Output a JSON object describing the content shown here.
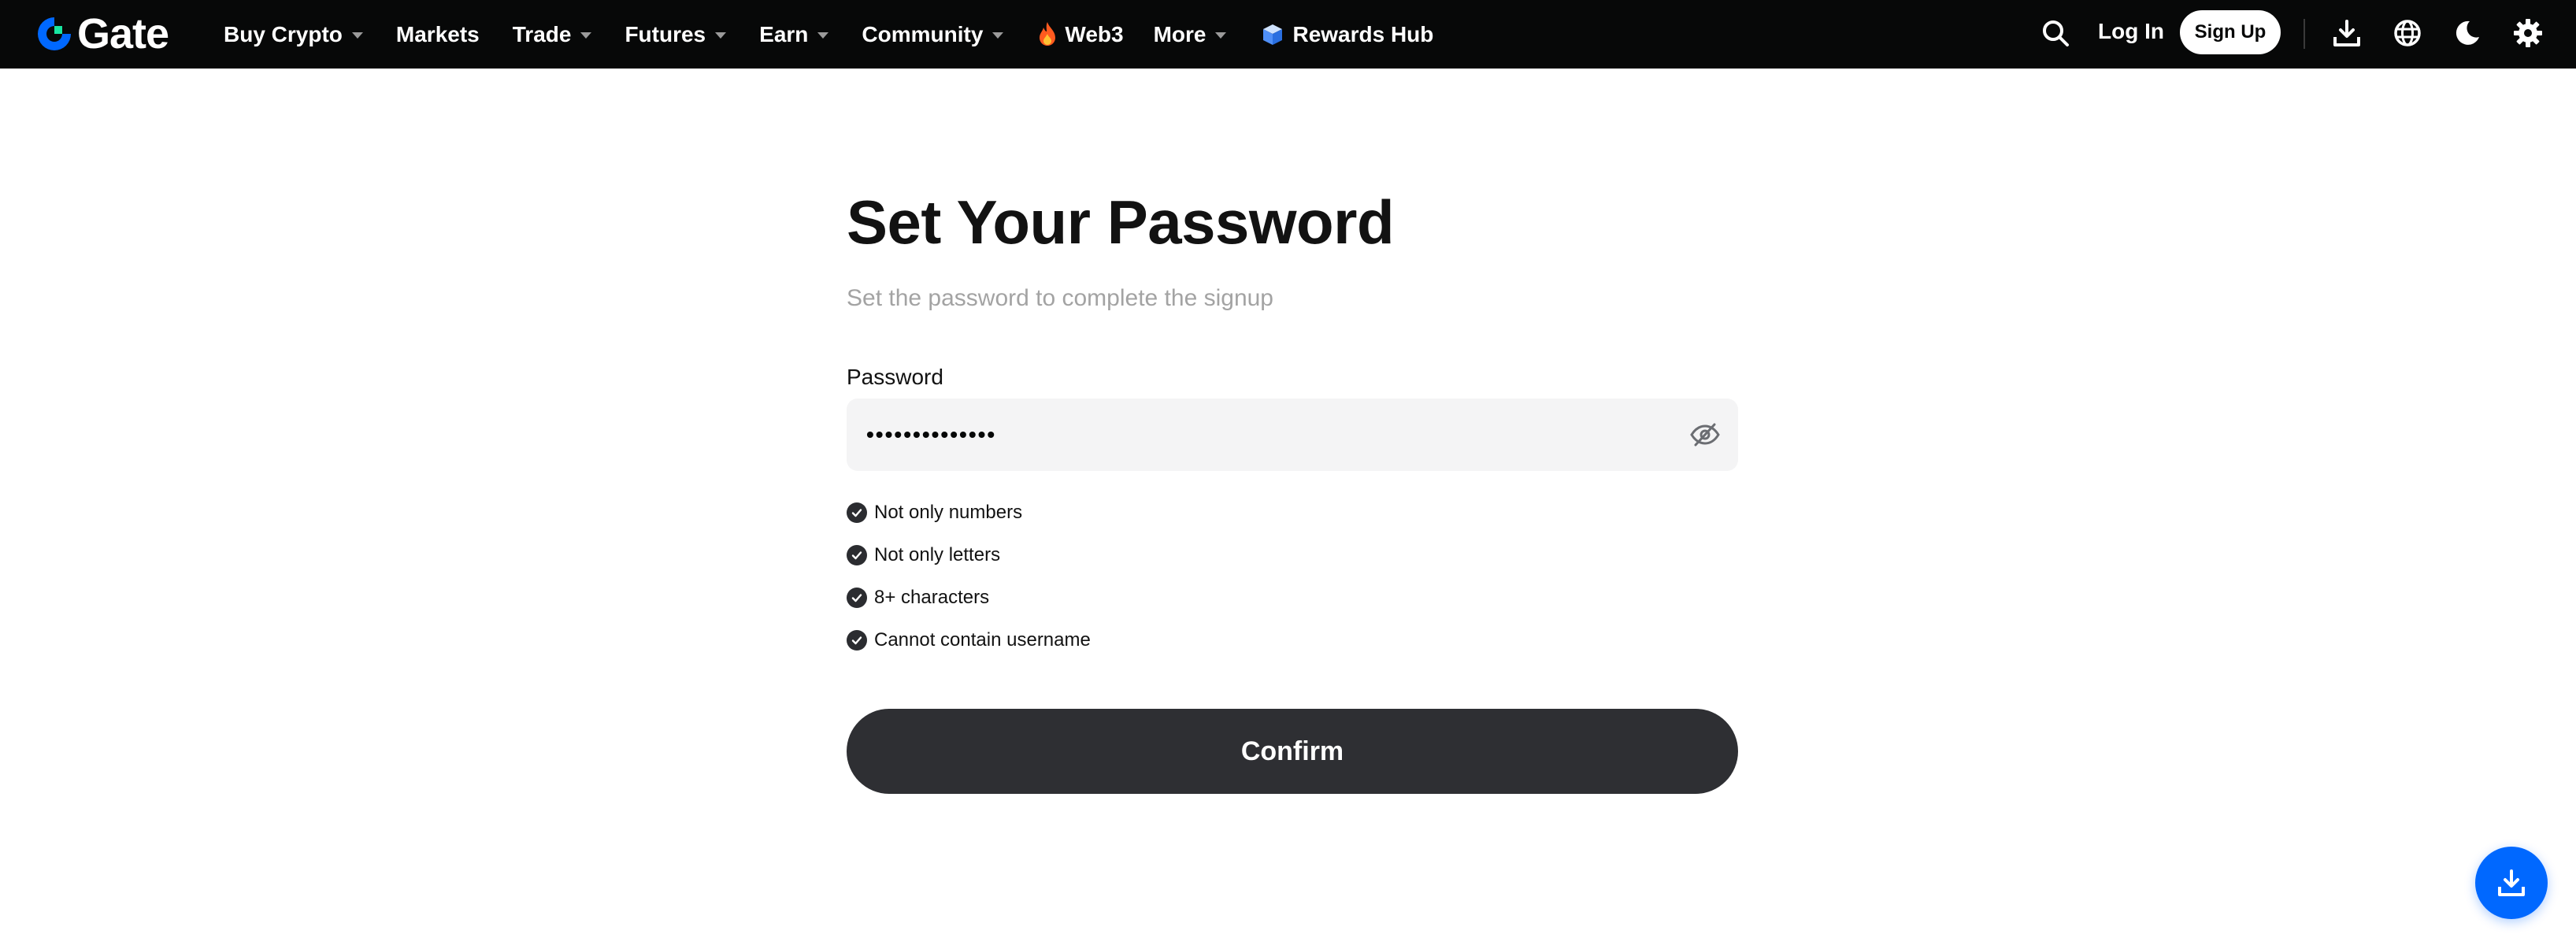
{
  "header": {
    "logo_text": "Gate",
    "nav": [
      {
        "label": "Buy Crypto",
        "has_caret": true
      },
      {
        "label": "Markets",
        "has_caret": false
      },
      {
        "label": "Trade",
        "has_caret": true
      },
      {
        "label": "Futures",
        "has_caret": true
      },
      {
        "label": "Earn",
        "has_caret": true
      },
      {
        "label": "Community",
        "has_caret": true
      },
      {
        "label": "Web3",
        "has_caret": false,
        "icon": "flame-icon"
      },
      {
        "label": "More",
        "has_caret": true
      },
      {
        "label": "Rewards Hub",
        "has_caret": false,
        "icon": "cube-icon"
      }
    ],
    "login_label": "Log In",
    "signup_label": "Sign Up",
    "right_icons": [
      "search-icon",
      "download-icon",
      "globe-icon",
      "moon-icon",
      "gear-icon"
    ]
  },
  "form": {
    "title": "Set Your Password",
    "subtitle": "Set the password to complete the signup",
    "password_label": "Password",
    "password_value": "••••••••••••••",
    "rules": [
      {
        "label": "Not only numbers",
        "satisfied": true
      },
      {
        "label": "Not only letters",
        "satisfied": true
      },
      {
        "label": "8+ characters",
        "satisfied": true
      },
      {
        "label": "Cannot contain username",
        "satisfied": true
      }
    ],
    "confirm_label": "Confirm"
  },
  "colors": {
    "nav_bg": "#070808",
    "brand_blue": "#0068ff",
    "brand_green": "#17e6a1",
    "button_dark": "#2e2f33"
  }
}
